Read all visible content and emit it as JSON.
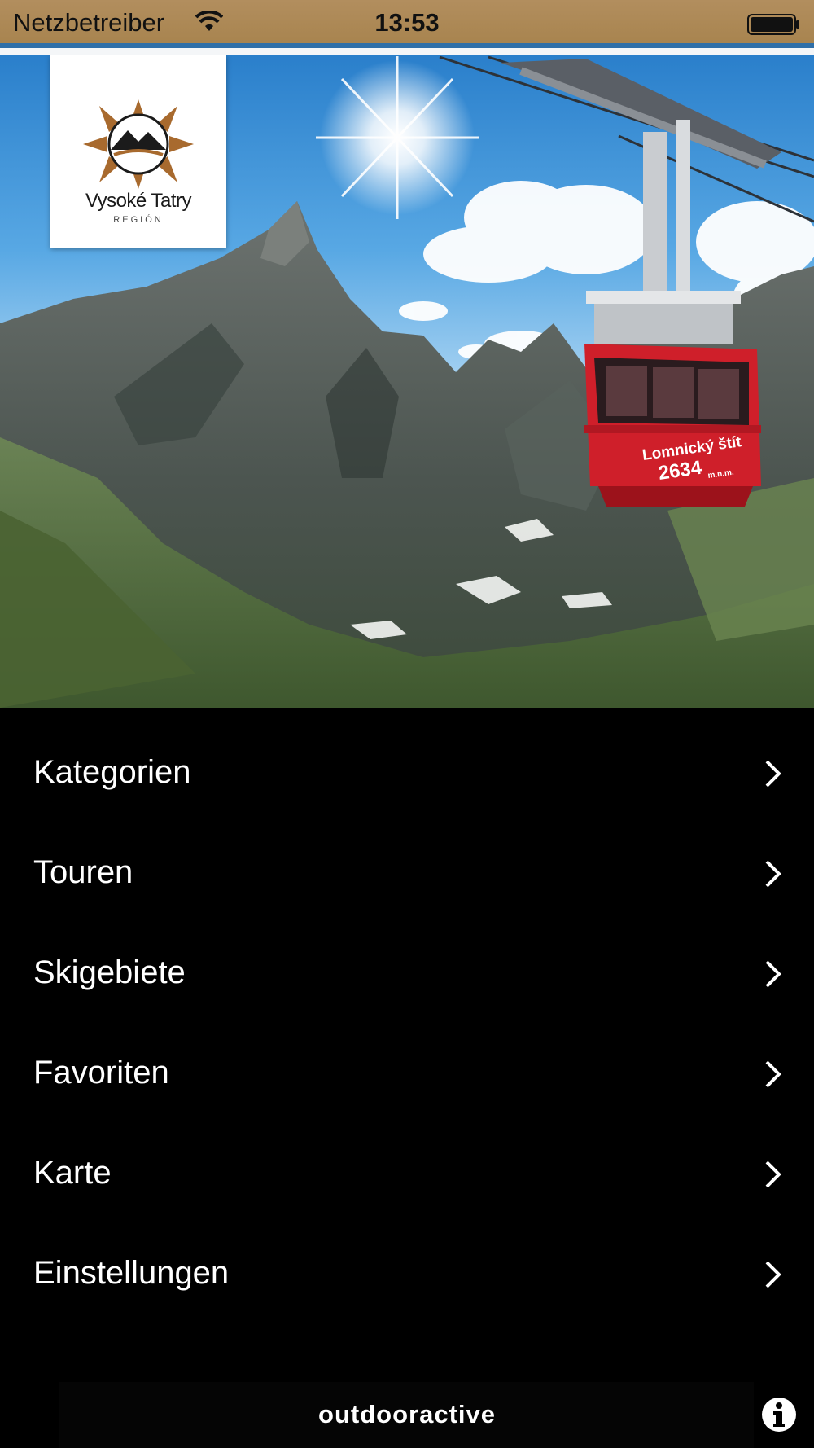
{
  "status_bar": {
    "carrier": "Netzbetreiber",
    "time": "13:53"
  },
  "logo": {
    "name": "Vysoké Tatry",
    "subtitle": "REGIÓN"
  },
  "hero": {
    "cabin_sign_line1": "Lomnický štít",
    "cabin_sign_line2": "2634",
    "cabin_sign_unit": "m.n.m."
  },
  "menu": {
    "items": [
      {
        "label": "Kategorien"
      },
      {
        "label": "Touren"
      },
      {
        "label": "Skigebiete"
      },
      {
        "label": "Favoriten"
      },
      {
        "label": "Karte"
      },
      {
        "label": "Einstellungen"
      }
    ]
  },
  "footer": {
    "brand": "outdooractive"
  },
  "colors": {
    "status_bar": "#a8844f",
    "menu_background": "#000000",
    "menu_text": "#ffffff",
    "cabin_red": "#d4202c"
  }
}
